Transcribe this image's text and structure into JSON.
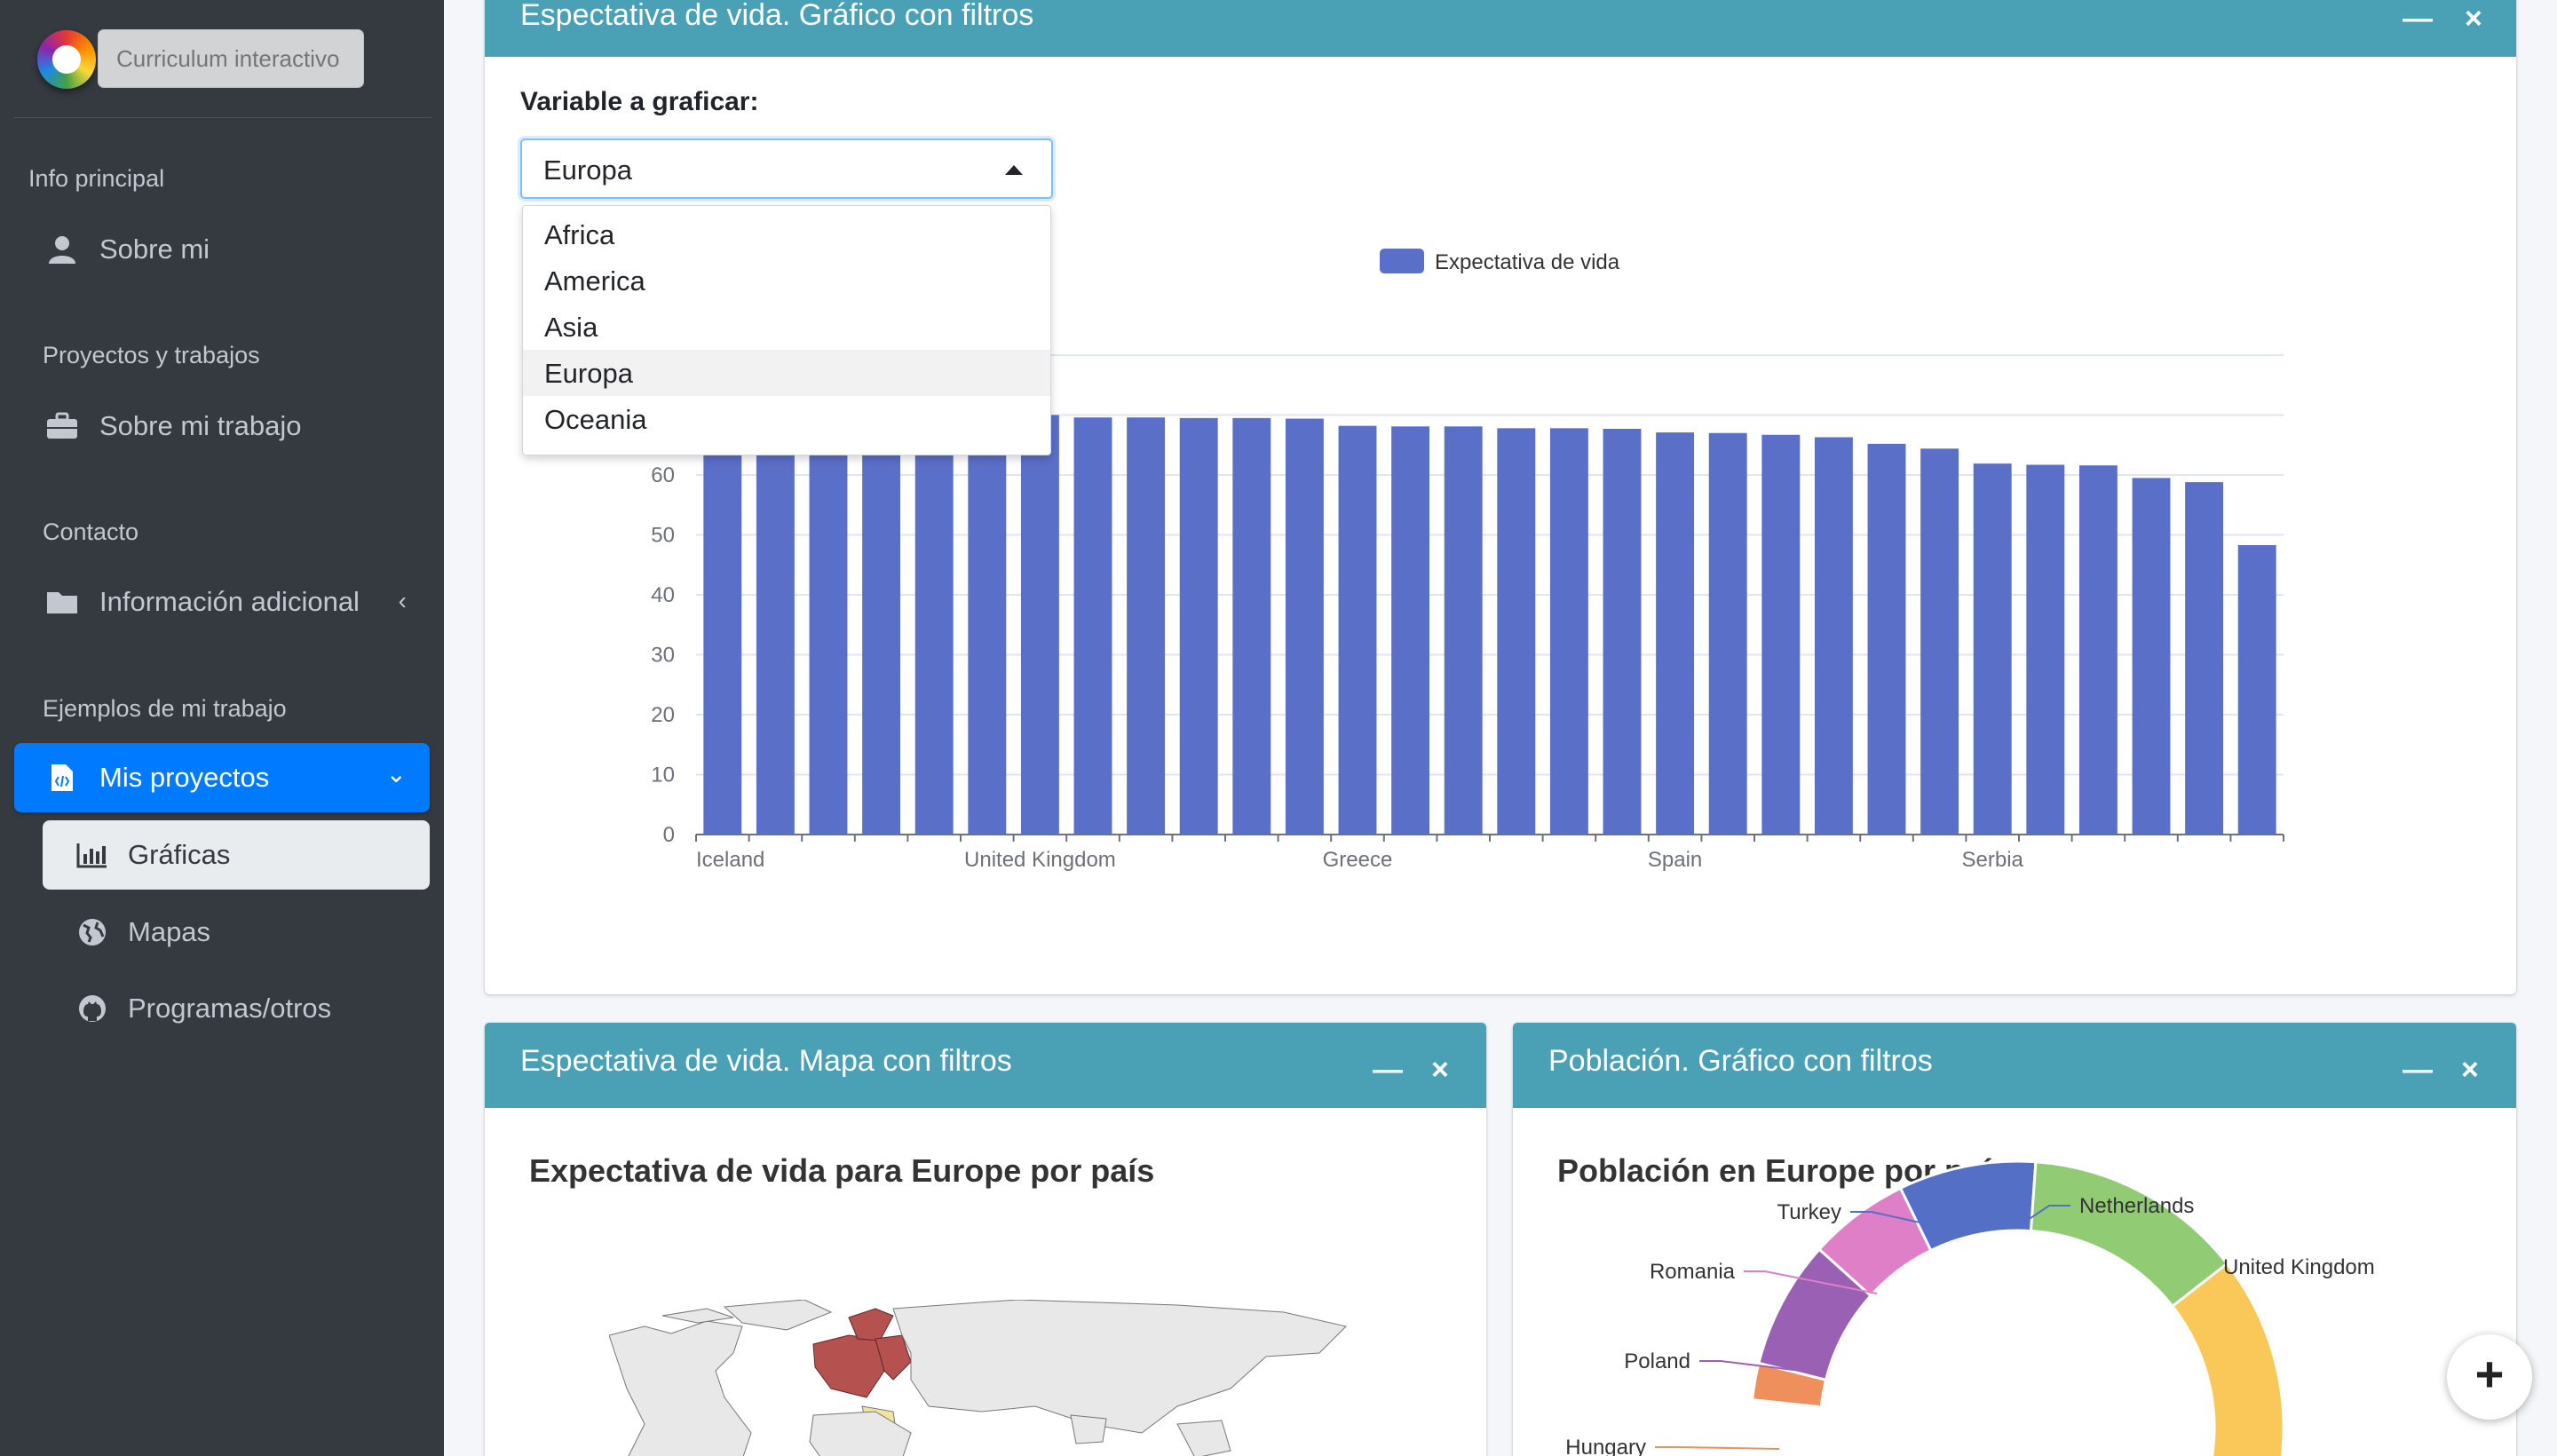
{
  "sidebar": {
    "brand_placeholder": "Curriculum interactivo",
    "sections": [
      {
        "header": "Info principal",
        "items": [
          {
            "label": "Sobre mi",
            "icon": "user-icon"
          }
        ]
      },
      {
        "header": "Proyectos y trabajos",
        "items": [
          {
            "label": "Sobre mi trabajo",
            "icon": "briefcase-icon"
          }
        ]
      },
      {
        "header": "Contacto",
        "items": [
          {
            "label": "Información adicional",
            "icon": "folder-icon"
          }
        ]
      },
      {
        "header": "Ejemplos de mi trabajo",
        "items": [
          {
            "label": "Mis proyectos",
            "icon": "file-code-icon"
          }
        ]
      }
    ],
    "subitems": [
      {
        "label": "Gráficas",
        "icon": "bar-chart-icon"
      },
      {
        "label": "Mapas",
        "icon": "globe-icon"
      },
      {
        "label": "Programas/otros",
        "icon": "github-icon"
      }
    ],
    "active_color": "#007bff"
  },
  "cards": {
    "top": {
      "title": "Espectativa de vida. Gráfico con filtros",
      "variable_label": "Variable a graficar:",
      "select_value": "Europa",
      "options": [
        "Africa",
        "America",
        "Asia",
        "Europa",
        "Oceania"
      ],
      "selected_option": "Europa"
    },
    "map": {
      "title": "Espectativa de vida. Mapa con filtros",
      "chart_title": "Expectativa de vida para Europe por país"
    },
    "population": {
      "title": "Población. Gráfico con filtros",
      "chart_title": "Población en Europe por país",
      "donut_labels": [
        "Turkey",
        "Netherlands",
        "Romania",
        "United Kingdom",
        "Poland",
        "Hungary"
      ]
    },
    "header_color": "#4aa0b5",
    "minimize_glyph": "—",
    "close_glyph": "×"
  },
  "fab": {
    "glyph": "+"
  },
  "chart_data": [
    {
      "type": "bar",
      "legend": "Expectativa de vida",
      "color": "#5a6fc7",
      "ylim": [
        0,
        80
      ],
      "yticks": [
        0,
        10,
        20,
        30,
        40,
        50,
        60
      ],
      "xtick_labels": [
        {
          "index": 0,
          "label": "Iceland"
        },
        {
          "index": 6,
          "label": "United Kingdom"
        },
        {
          "index": 12,
          "label": "Greece"
        },
        {
          "index": 18,
          "label": "Spain"
        },
        {
          "index": 24,
          "label": "Serbia"
        }
      ],
      "values": [
        70.9,
        70.6,
        70.6,
        70.5,
        70.3,
        70.2,
        70.0,
        69.6,
        69.6,
        69.5,
        69.5,
        69.4,
        68.2,
        68.1,
        68.1,
        67.8,
        67.8,
        67.7,
        67.1,
        67.0,
        66.7,
        66.3,
        65.2,
        64.4,
        61.9,
        61.7,
        61.6,
        59.5,
        58.8,
        48.3
      ]
    },
    {
      "type": "pie",
      "title": "Población en Europe por país",
      "labels": [
        "Turkey",
        "Netherlands",
        "United Kingdom",
        "Romania",
        "Poland",
        "Hungary"
      ],
      "colors": [
        "#5470c6",
        "#91cc75",
        "#fac858",
        "#de7fc8",
        "#9a60b4",
        "#ee8f5c"
      ]
    }
  ]
}
